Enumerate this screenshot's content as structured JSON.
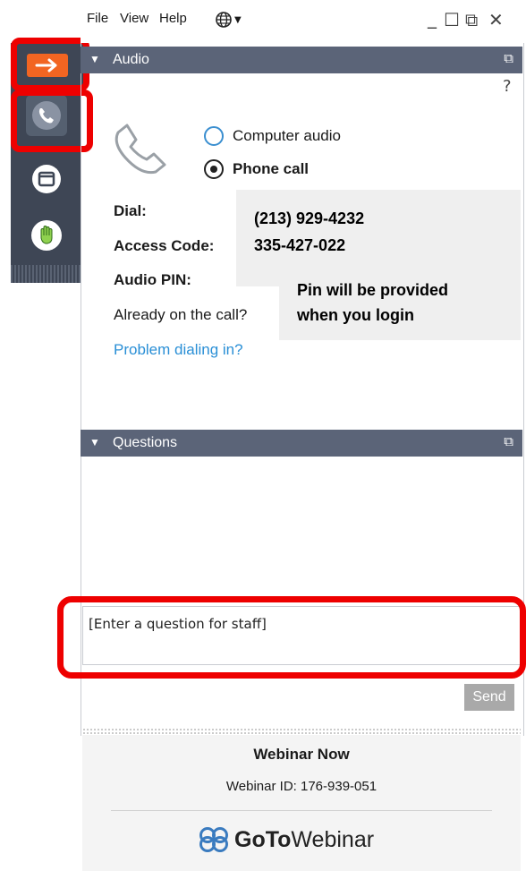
{
  "menu": {
    "file": "File",
    "view": "View",
    "help": "Help"
  },
  "window_controls": {
    "minimize": "_",
    "maximize": "☐",
    "popout": "⧉",
    "close": "✕"
  },
  "audio_panel": {
    "title": "Audio",
    "help_mark": "?",
    "options": [
      {
        "label": "Computer audio",
        "selected": false
      },
      {
        "label": "Phone call",
        "selected": true
      }
    ],
    "dial_label": "Dial:",
    "access_code_label": "Access Code:",
    "audio_pin_label": "Audio PIN:",
    "already_label": "Already on the call?",
    "problem_link": "Problem dialing in?",
    "phone_number": "(213) 929-4232",
    "access_code": "335-427-022",
    "pin_line1": "Pin will be provided",
    "pin_line2": "when you login"
  },
  "questions_panel": {
    "title": "Questions",
    "input_value": "[Enter a question for staff]",
    "send_label": "Send"
  },
  "footer": {
    "webinar_name": "Webinar Now",
    "webinar_id": "Webinar ID: 176-939-051",
    "brand_bold": "GoTo",
    "brand_regular": "Webinar"
  },
  "colors": {
    "panel_header": "#5b6478",
    "rail": "#3e4655",
    "accent_orange": "#f26522",
    "link_blue": "#2a8fd6",
    "highlight_red": "#ee0000"
  },
  "icons": {
    "menu_language": "globe-icon",
    "rail_collapse": "arrow-right-icon",
    "rail_audio": "phone-icon",
    "rail_window": "window-icon",
    "rail_raise_hand": "hand-icon",
    "audio_glyph": "phone-handset-icon",
    "brand_logo": "gotowebinar-logo-icon"
  }
}
